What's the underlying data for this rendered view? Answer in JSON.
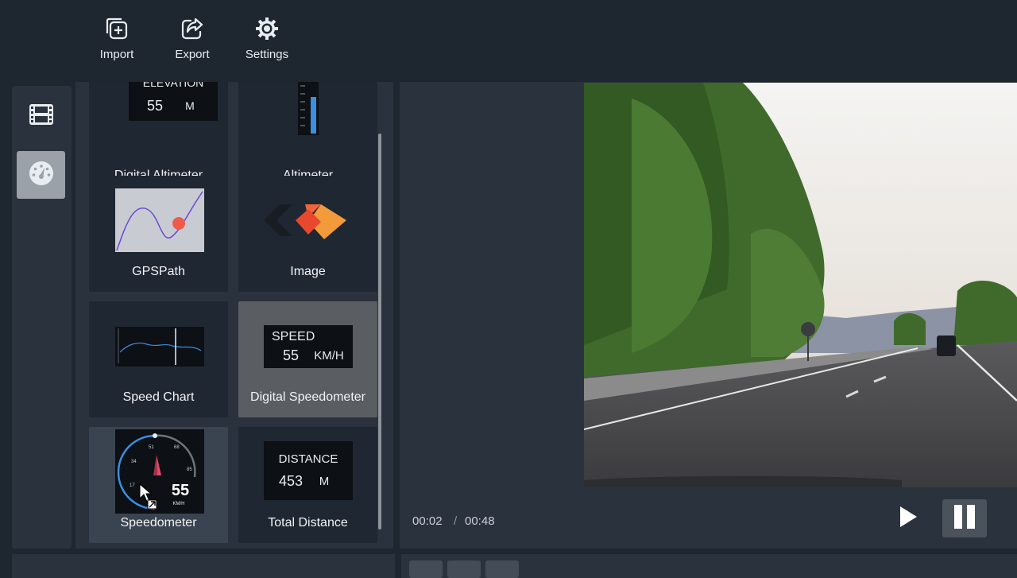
{
  "toolbar": {
    "import_label": "Import",
    "export_label": "Export",
    "settings_label": "Settings"
  },
  "rail": {
    "items": [
      {
        "icon": "film-icon",
        "active": false
      },
      {
        "icon": "gauge-icon",
        "active": true
      }
    ]
  },
  "widgets": {
    "digital_altimeter": {
      "label": "Digital Altimeter",
      "preview_title": "ELEVATION",
      "preview_value": "55",
      "preview_unit": "M"
    },
    "altimeter": {
      "label": "Altimeter"
    },
    "gpspath": {
      "label": "GPSPath"
    },
    "image": {
      "label": "Image"
    },
    "speed_chart": {
      "label": "Speed Chart"
    },
    "digital_speedometer": {
      "label": "Digital Speedometer",
      "preview_title": "SPEED",
      "preview_value": "55",
      "preview_unit": "KM/H"
    },
    "speedometer": {
      "label": "Speedometer",
      "preview_value": "55",
      "preview_unit": "KM/H",
      "ticks": [
        "34",
        "51",
        "68",
        "85",
        "17"
      ]
    },
    "total_distance": {
      "label": "Total Distance",
      "preview_title": "DISTANCE",
      "preview_value": "453",
      "preview_unit": "M"
    }
  },
  "player": {
    "current_time": "00:02",
    "separator": "/",
    "total_time": "00:48"
  },
  "colors": {
    "accent_blue": "#3a8fe0",
    "image_orange": "#f0643a",
    "gps_dot": "#f05a4a"
  }
}
